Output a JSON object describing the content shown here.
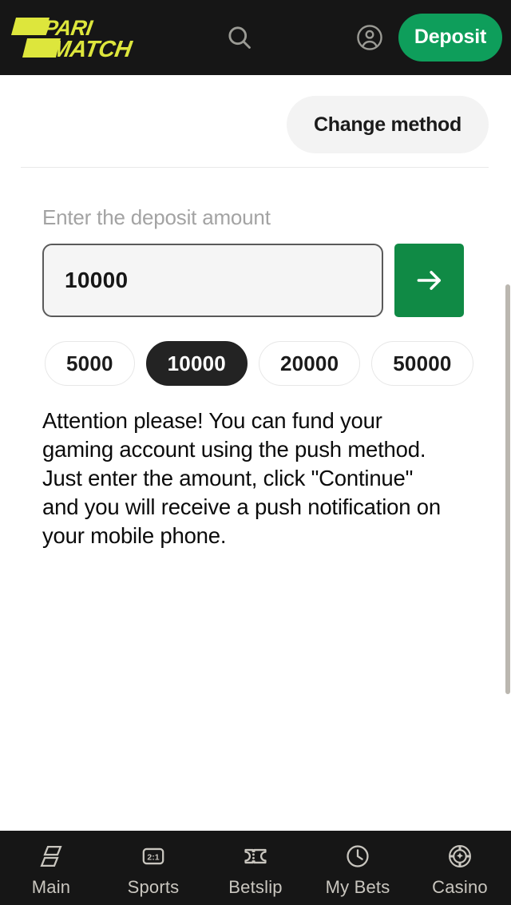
{
  "colors": {
    "header_bg": "#161616",
    "logo_yellow": "#DDE63C",
    "deposit_green": "#0E9E5B",
    "submit_green": "#108A45",
    "chip_selected_bg": "#232323",
    "nav_text": "#C9C6BF",
    "label_gray": "#A3A3A3",
    "scrollbar": "#BBB7B0"
  },
  "header": {
    "logo_line1": "PARI",
    "logo_line2": "MATCH",
    "search_icon": "search-icon",
    "account_icon": "account-circle-icon",
    "deposit_label": "Deposit"
  },
  "main": {
    "change_method_label": "Change method",
    "field_label": "Enter the deposit amount",
    "amount_value": "10000",
    "amount_placeholder": "Enter the deposit amount",
    "submit_icon": "arrow-right-icon",
    "chips": [
      {
        "label": "5000",
        "selected": false
      },
      {
        "label": "10000",
        "selected": true
      },
      {
        "label": "20000",
        "selected": false
      },
      {
        "label": "50000",
        "selected": false
      }
    ],
    "notice": "Attention please! You can fund your gaming account using the push method. Just enter the amount, click \"Continue\" and you will receive a push notification on your mobile phone."
  },
  "bottom_nav": {
    "items": [
      {
        "label": "Main",
        "icon": "parallelograms-icon"
      },
      {
        "label": "Sports",
        "icon": "scoreboard-icon",
        "icon_text": "2:1"
      },
      {
        "label": "Betslip",
        "icon": "ticket-icon"
      },
      {
        "label": "My Bets",
        "icon": "clock-icon"
      },
      {
        "label": "Casino",
        "icon": "casino-chip-icon"
      }
    ]
  }
}
